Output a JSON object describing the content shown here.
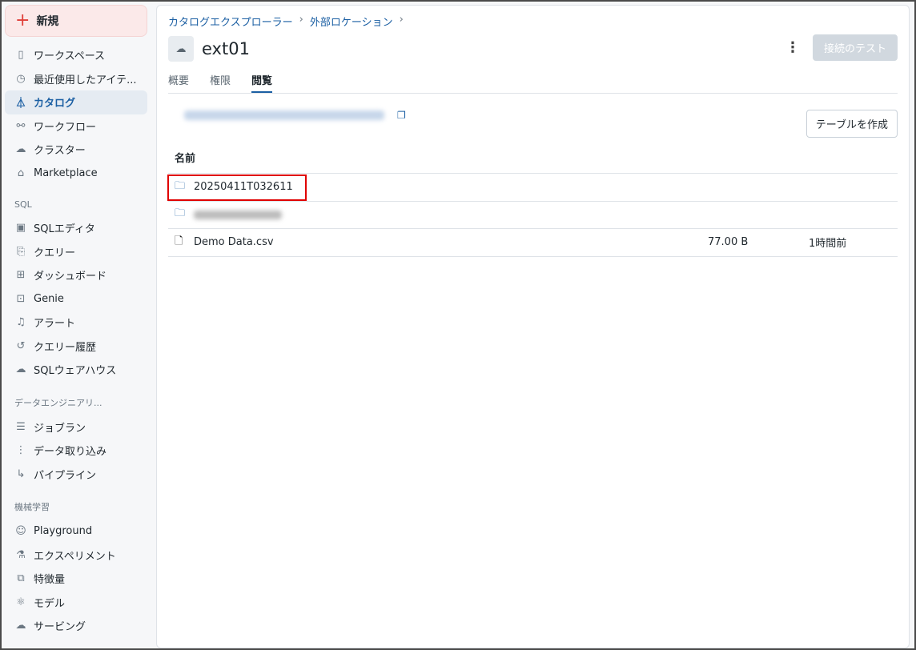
{
  "sidebar": {
    "new_label": "新規",
    "items": [
      {
        "label": "ワークスペース",
        "icon": "workspace-icon"
      },
      {
        "label": "最近使用したアイテ...",
        "icon": "clock-icon"
      },
      {
        "label": "カタログ",
        "icon": "catalog-icon",
        "active": true
      },
      {
        "label": "ワークフロー",
        "icon": "workflow-icon"
      },
      {
        "label": "クラスター",
        "icon": "cloud-icon"
      },
      {
        "label": "Marketplace",
        "icon": "store-icon"
      }
    ],
    "sql_heading": "SQL",
    "sql_items": [
      {
        "label": "SQLエディタ"
      },
      {
        "label": "クエリー"
      },
      {
        "label": "ダッシュボード"
      },
      {
        "label": "Genie"
      },
      {
        "label": "アラート"
      },
      {
        "label": "クエリー履歴"
      },
      {
        "label": "SQLウェアハウス"
      }
    ],
    "de_heading": "データエンジニアリ...",
    "de_items": [
      {
        "label": "ジョブラン"
      },
      {
        "label": "データ取り込み"
      },
      {
        "label": "パイプライン"
      }
    ],
    "ml_heading": "機械学習",
    "ml_items": [
      {
        "label": "Playground"
      },
      {
        "label": "エクスペリメント"
      },
      {
        "label": "特徴量"
      },
      {
        "label": "モデル"
      },
      {
        "label": "サービング"
      }
    ]
  },
  "breadcrumb": [
    "カタログエクスプローラー",
    "外部ロケーション"
  ],
  "title": "ext01",
  "actions": {
    "test_connection": "接続のテスト",
    "create_table": "テーブルを作成"
  },
  "tabs": [
    "概要",
    "権限",
    "閲覧"
  ],
  "table": {
    "header": "名前",
    "rows": [
      {
        "name": "20250411T032611",
        "type": "folder"
      },
      {
        "name": "",
        "type": "folder"
      },
      {
        "name": "Demo Data.csv",
        "type": "file",
        "size": "77.00 B",
        "modified": "1時間前"
      }
    ]
  }
}
